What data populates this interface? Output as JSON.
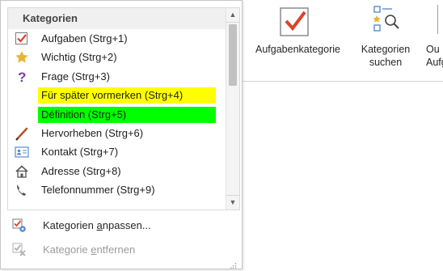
{
  "ribbon": {
    "aufgabenkategorie": {
      "label": "Aufgabenkategorie",
      "icon": "checkmark-category-icon"
    },
    "kategorien_suchen": {
      "line1": "Kategorien",
      "line2": "suchen",
      "icon": "find-categories-icon"
    },
    "cut_off": {
      "line1": "Ou",
      "line2": "Aufg"
    }
  },
  "categories": {
    "header": "Kategorien",
    "items": [
      {
        "label": "Aufgaben (Strg+1)",
        "icon": "checkbox-check-icon",
        "highlight": ""
      },
      {
        "label": "Wichtig (Strg+2)",
        "icon": "star-icon",
        "highlight": ""
      },
      {
        "label": "Frage (Strg+3)",
        "icon": "question-mark-icon",
        "highlight": ""
      },
      {
        "label": "Für später vormerken (Strg+4)",
        "icon": "",
        "highlight": "#ffff00"
      },
      {
        "label": "Définition (Strg+5)",
        "icon": "",
        "highlight": "#00ff00"
      },
      {
        "label": "Hervorheben (Strg+6)",
        "icon": "highlighter-pen-icon",
        "highlight": ""
      },
      {
        "label": "Kontakt (Strg+7)",
        "icon": "contact-card-icon",
        "highlight": ""
      },
      {
        "label": "Adresse (Strg+8)",
        "icon": "house-icon",
        "highlight": ""
      },
      {
        "label": "Telefonnummer (Strg+9)",
        "icon": "phone-icon",
        "highlight": ""
      }
    ]
  },
  "actions": {
    "anpassen": {
      "prefix": "Kategorien ",
      "underlined": "a",
      "suffix": "npassen...",
      "icon": "customize-categories-icon"
    },
    "entfernen": {
      "prefix": "Kategorie ",
      "underlined": "e",
      "suffix": "ntfernen",
      "icon": "remove-category-icon"
    }
  }
}
